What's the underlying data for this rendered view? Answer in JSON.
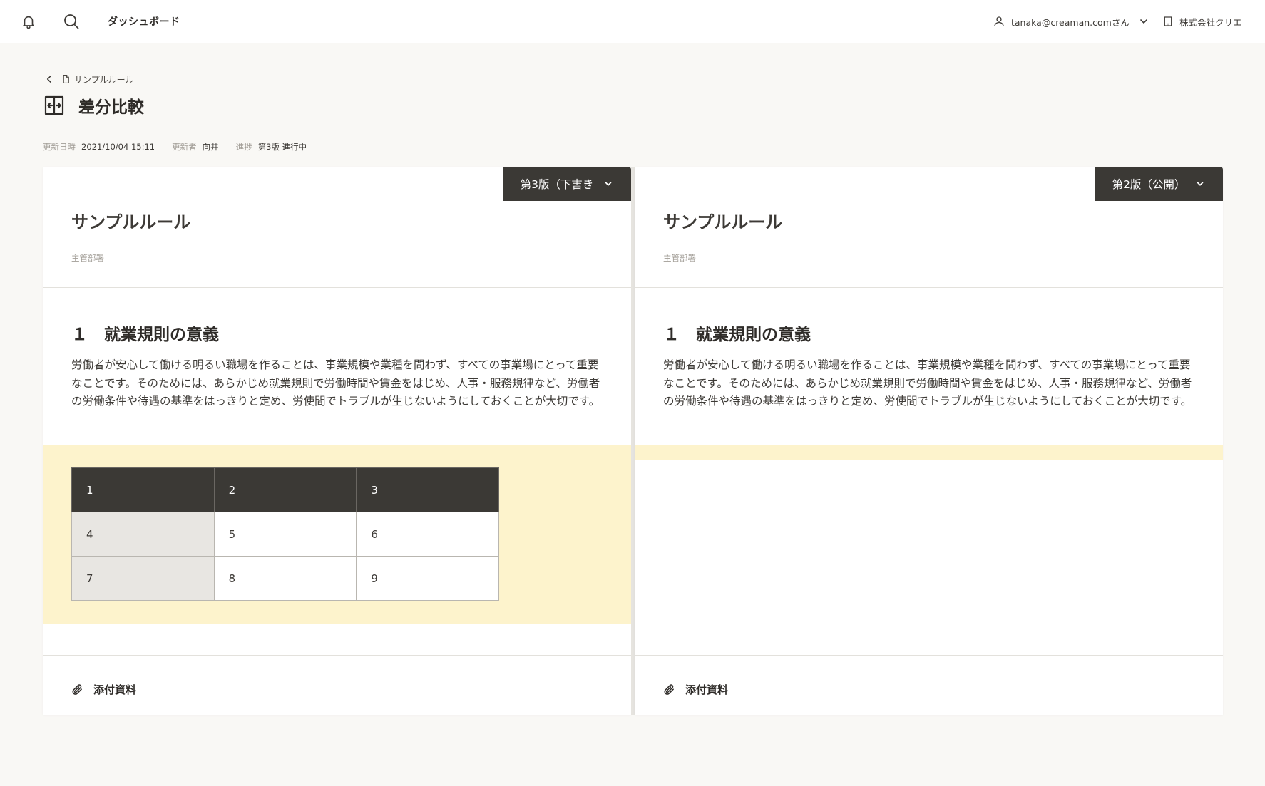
{
  "header": {
    "nav_label": "ダッシュボード",
    "user_email": "tanaka@creaman.comさん",
    "company": "株式会社クリエ"
  },
  "breadcrumb": {
    "label": "サンプルルール"
  },
  "page": {
    "title": "差分比較"
  },
  "meta": {
    "updated_label": "更新日時",
    "updated_value": "2021/10/04 15:11",
    "updater_label": "更新者",
    "updater_value": "向井",
    "progress_label": "進捗",
    "progress_value": "第3版 進行中"
  },
  "left": {
    "version": "第3版（下書き",
    "doc_title": "サンプルルール",
    "dept_label": "主管部署",
    "section_title": "１　就業規則の意義",
    "body": "労働者が安心して働ける明るい職場を作ることは、事業規模や業種を問わず、すべての事業場にとって重要なことです。そのためには、あらかじめ就業規則で労働時間や賃金をはじめ、人事・服務規律など、労働者の労働条件や待遇の基準をはっきりと定め、労使間でトラブルが生じないようにしておくことが大切です。",
    "table": [
      [
        "1",
        "2",
        "3"
      ],
      [
        "4",
        "5",
        "6"
      ],
      [
        "7",
        "8",
        "9"
      ]
    ],
    "attachments": "添付資料"
  },
  "right": {
    "version": "第2版（公開）",
    "doc_title": "サンプルルール",
    "dept_label": "主管部署",
    "section_title": "１　就業規則の意義",
    "body": "労働者が安心して働ける明るい職場を作ることは、事業規模や業種を問わず、すべての事業場にとって重要なことです。そのためには、あらかじめ就業規則で労働時間や賃金をはじめ、人事・服務規律など、労働者の労働条件や待遇の基準をはっきりと定め、労使間でトラブルが生じないようにしておくことが大切です。",
    "attachments": "添付資料"
  },
  "colors": {
    "background": "#f9f8f5",
    "dark": "#3b3935",
    "highlight": "#fdf3cc",
    "row_header": "#e8e6e2"
  },
  "icons": [
    "bell-icon",
    "search-icon",
    "user-icon",
    "chevron-down-icon",
    "building-icon",
    "chevron-left-icon",
    "file-icon",
    "diff-icon",
    "paperclip-icon"
  ]
}
